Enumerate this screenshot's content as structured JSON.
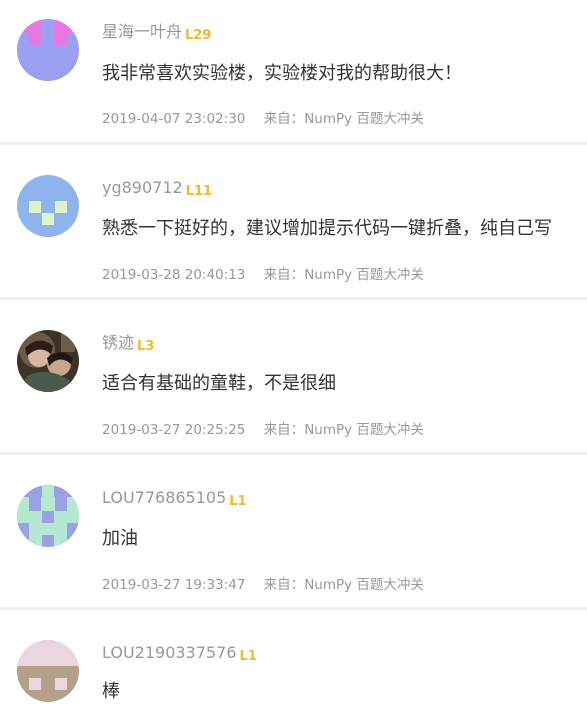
{
  "comments": [
    {
      "username": "星海一叶舟",
      "level": "L29",
      "content": "我非常喜欢实验楼，实验楼对我的帮助很大！",
      "time": "2019-04-07 23:02:30",
      "source_prefix": "来自：",
      "source": "NumPy 百题大冲关"
    },
    {
      "username": "yg890712",
      "level": "L11",
      "content": "熟悉一下挺好的，建议增加提示代码一键折叠，纯自己写",
      "time": "2019-03-28 20:40:13",
      "source_prefix": "来自：",
      "source": "NumPy 百题大冲关"
    },
    {
      "username": "锈迹",
      "level": "L3",
      "content": "适合有基础的童鞋，不是很细",
      "time": "2019-03-27 20:25:25",
      "source_prefix": "来自：",
      "source": "NumPy 百题大冲关"
    },
    {
      "username": "LOU776865105",
      "level": "L1",
      "content": "加油",
      "time": "2019-03-27 19:33:47",
      "source_prefix": "来自：",
      "source": "NumPy 百题大冲关"
    },
    {
      "username": "LOU2190337576",
      "level": "L1",
      "content": "棒",
      "time": "",
      "source_prefix": "",
      "source": ""
    }
  ],
  "colors": {
    "level_badge": "#f5b731",
    "meta_text": "#999999",
    "content_text": "#333333",
    "separator": "#eeeeee"
  }
}
